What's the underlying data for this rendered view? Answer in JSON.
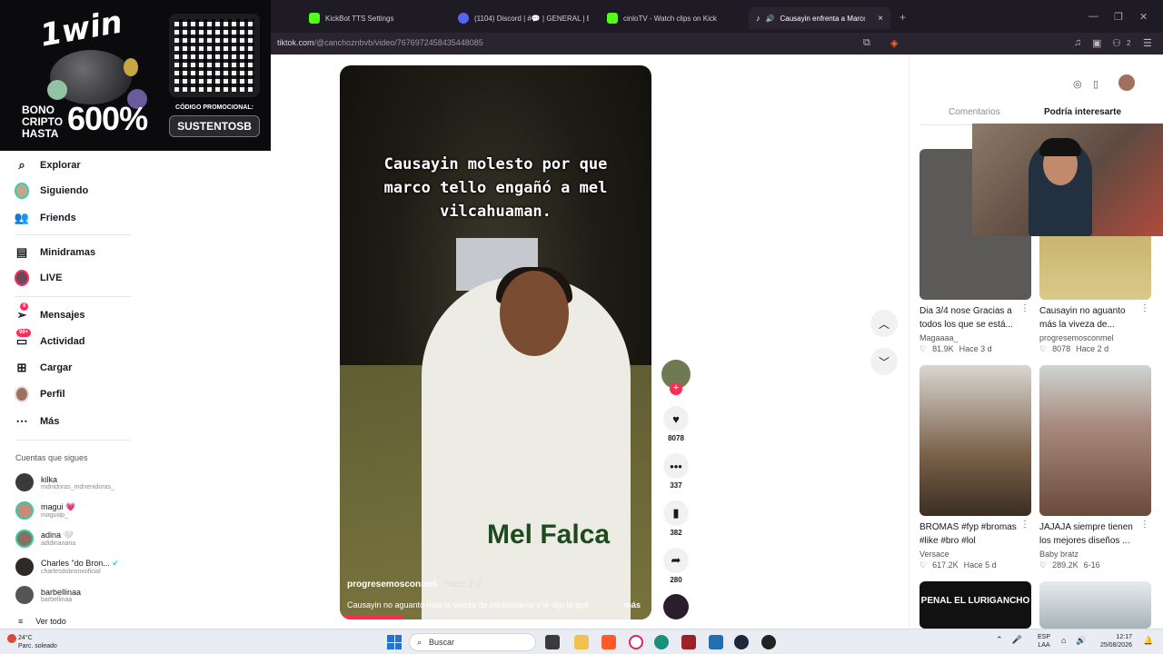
{
  "browser": {
    "tabs": [
      {
        "label": "KickBot TTS Settings",
        "color": "#53fc18"
      },
      {
        "label": "(1104) Discord | #💬 | GENERAL | EISUS...",
        "color": "#5865f2"
      },
      {
        "label": "cinloTV - Watch clips on Kick",
        "color": "#53fc18"
      },
      {
        "label": "Causayin enfrenta a Marco Te",
        "color": "#ffffff"
      }
    ],
    "url_host": "tiktok.com",
    "url_path": "/@canchoznbvb/video/7676972458435448085",
    "ext_count": "2"
  },
  "ad": {
    "brand": "1win",
    "bono_lines": [
      "BONO",
      "CRIPTO",
      "HASTA"
    ],
    "percent": "600%",
    "code_label": "CÓDIGO PROMOCIONAL:",
    "code": "SUSTENTOSB"
  },
  "nav": {
    "items": [
      {
        "label": "Explorar",
        "icon": "compass-icon"
      },
      {
        "label": "Siguiendo",
        "icon": "avatar"
      },
      {
        "label": "Friends",
        "icon": "friends-icon"
      },
      {
        "label": "Minidramas",
        "icon": "film-icon"
      },
      {
        "label": "LIVE",
        "icon": "avatar"
      },
      {
        "label": "Mensajes",
        "icon": "send-icon",
        "badge": "8"
      },
      {
        "label": "Actividad",
        "icon": "inbox-icon",
        "badge": "99+"
      },
      {
        "label": "Cargar",
        "icon": "plus-square-icon"
      },
      {
        "label": "Perfil",
        "icon": "avatar"
      },
      {
        "label": "Más",
        "icon": "more-icon"
      }
    ],
    "following_heading": "Cuentas que sigues",
    "following": [
      {
        "name": "kilka",
        "user": "mdnidoras_mdnenidoras_"
      },
      {
        "name": "magui 💗",
        "user": "maguiiip_"
      },
      {
        "name": "adina 🤍",
        "user": "adidinanana"
      },
      {
        "name": "Charles \"do Bron...",
        "user": "charlesdobronxoficial"
      },
      {
        "name": "barbellinaa",
        "user": "barbellinaa"
      }
    ],
    "see_all": "Ver todo"
  },
  "video": {
    "caption_lines": [
      "Causayin molesto por que",
      "marco tello engañó a mel",
      "vilcahuaman."
    ],
    "shirt_text": "Mel Falca",
    "author": "progresemosconmel",
    "time": "· Hace 2 d",
    "description": "Causayin no aguanto más la viveza de contrincante y le dijo lo que",
    "more": "más",
    "progress": 0.2,
    "actions": {
      "likes": "8078",
      "comments": "337",
      "saves": "382",
      "shares": "280"
    }
  },
  "right": {
    "tabs": [
      "Comentarios",
      "Podría interesarte"
    ],
    "cards": [
      {
        "title": "Dia 3/4 nose Gracias a todos los que se está...",
        "author": "Magaaaa_",
        "views": "81.9K",
        "time": "Hace 3 d",
        "bg": "#5b5a58"
      },
      {
        "title": "Causayin no aguanto más la viveza de...",
        "author": "progresemosconmel",
        "views": "8078",
        "time": "Hace 2 d",
        "bg": "#b59a4e"
      },
      {
        "title": "BROMAS #fyp #bromas #like #bro #lol",
        "author": "Versace",
        "views": "617.2K",
        "time": "Hace 5 d",
        "bg": "#7a6049"
      },
      {
        "title": "JAJAJA siempre tienen los mejores diseños ...",
        "author": "Baby bratz",
        "views": "289.2K",
        "time": "6-16",
        "bg": "#a88a7e"
      },
      {
        "title": "PENAL EL LURIGANCHO",
        "bg": "#111111"
      },
      {
        "title": "",
        "bg": "#a8b3b8"
      }
    ]
  },
  "taskbar": {
    "temp": "24°C",
    "weather": "Parc. soleado",
    "search": "Buscar",
    "lang1": "ESP",
    "lang2": "LAA",
    "time": "12:17",
    "date": "25/08/2026"
  }
}
